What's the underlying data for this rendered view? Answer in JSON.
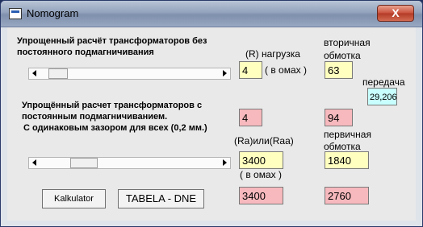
{
  "window": {
    "title": "Nomogram",
    "close_label": "X"
  },
  "labels": {
    "header1_line1": "Упрощенный расчёт трансформаторов без",
    "header1_line2": "постоянного подмагничивания",
    "r_load": "(R)  нагрузка",
    "in_ohms1": "( в омах )",
    "secondary_line1": "вторичная",
    "secondary_line2": "обмотка",
    "transfer": "передача",
    "header2_line1": "Упрощённый расчет трансформаторов с",
    "header2_line2": "постоянным подмагничиванием.",
    "header2_line3": "С одинаковым зазором для всех (0,2 мм.)",
    "ra_raa": "(Ra)или(Raa)",
    "primary_line1": "первичная",
    "primary_line2": "обмотка",
    "in_ohms2": "( в омах )"
  },
  "fields": {
    "r_load_value": "4",
    "secondary_value": "63",
    "transfer_value": "29,206",
    "r_load_calc": "4",
    "secondary_calc": "94",
    "ra_value": "3400",
    "primary_value": "1840",
    "ra_calc": "3400",
    "primary_calc": "2760"
  },
  "buttons": {
    "kalkulator": "Kalkulator",
    "tabela": "TABELA - DNE"
  },
  "sliders": {
    "slider1_position": 0.05,
    "slider2_position": 0.2
  },
  "colors": {
    "input_yellow": "#ffffc0",
    "result_pink": "#f7b9bd",
    "result_cyan": "#c8ffff"
  }
}
